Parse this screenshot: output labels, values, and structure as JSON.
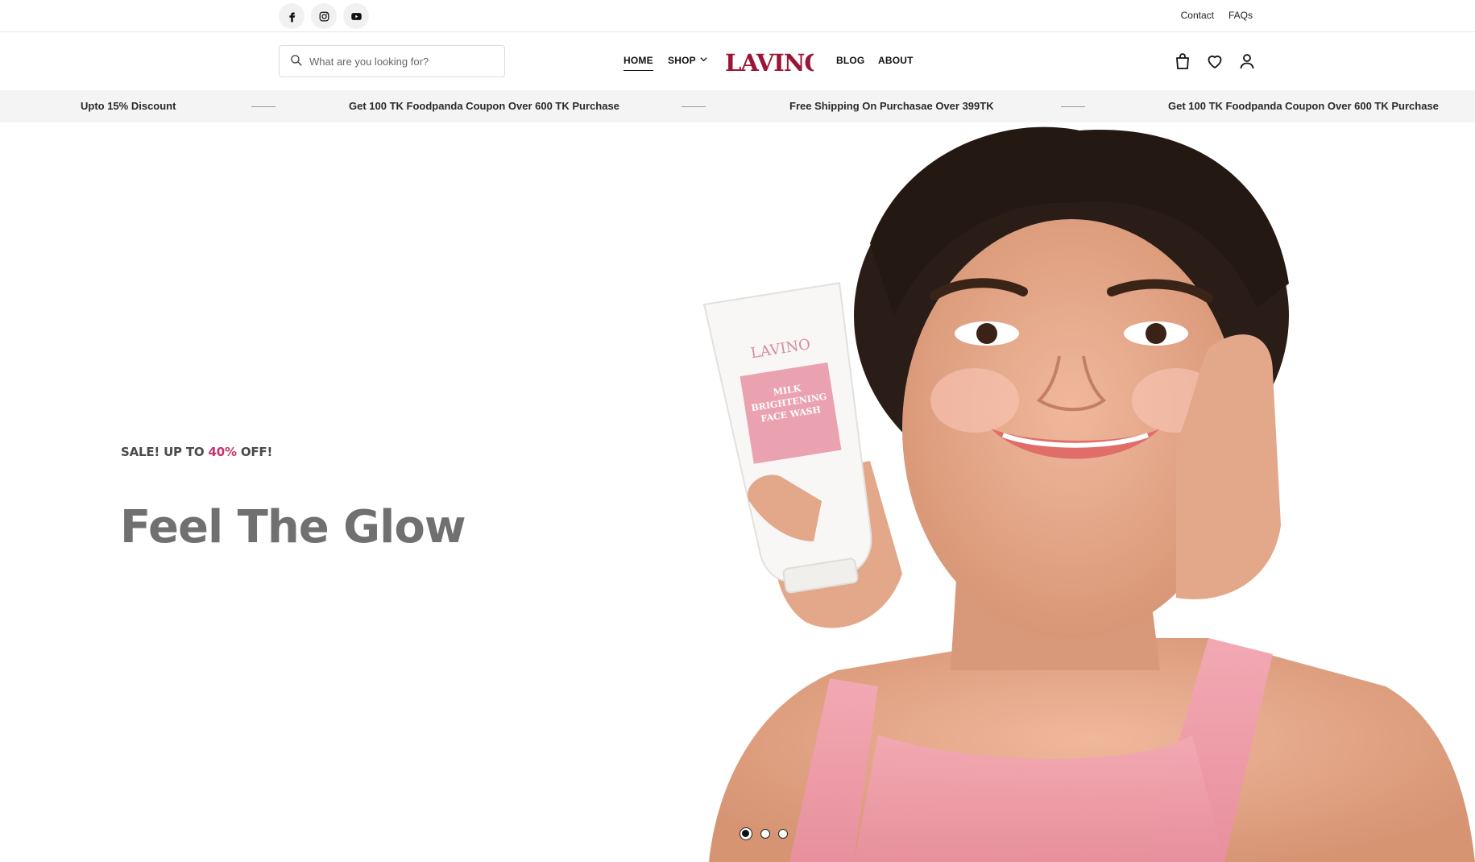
{
  "topbar": {
    "social": [
      {
        "icon": "facebook-icon"
      },
      {
        "icon": "instagram-icon"
      },
      {
        "icon": "youtube-icon"
      }
    ],
    "links": [
      "Contact",
      "FAQs"
    ]
  },
  "header": {
    "search_placeholder": "What are you looking for?",
    "nav": {
      "home": "HOME",
      "shop": "SHOP",
      "blog": "BLOG",
      "about": "ABOUT"
    },
    "logo_text": "LAVINO",
    "icons": [
      "shopping-bag-icon",
      "heart-icon",
      "user-icon"
    ]
  },
  "announcement": {
    "messages": [
      "Upto 15% Discount",
      "Get 100 TK Foodpanda Coupon Over 600 TK Purchase",
      "Free Shipping On Purchasae Over 399TK",
      "Get 100 TK Foodpanda Coupon Over 600 TK Purchase"
    ]
  },
  "hero": {
    "promo_prefix": "SALE! UP TO ",
    "promo_percent": "40%",
    "promo_suffix": " OFF!",
    "title": "Feel The Glow",
    "product_brand": "LAVINO",
    "product_label": [
      "MILK",
      "BRIGHTENING",
      "FACE WASH"
    ],
    "slides_total": 3,
    "active_slide": 1
  },
  "colors": {
    "brand": "#9b1537",
    "accent_pink": "#c8346a",
    "title_gray": "#707070",
    "announce_bg": "#f4f4f4"
  }
}
